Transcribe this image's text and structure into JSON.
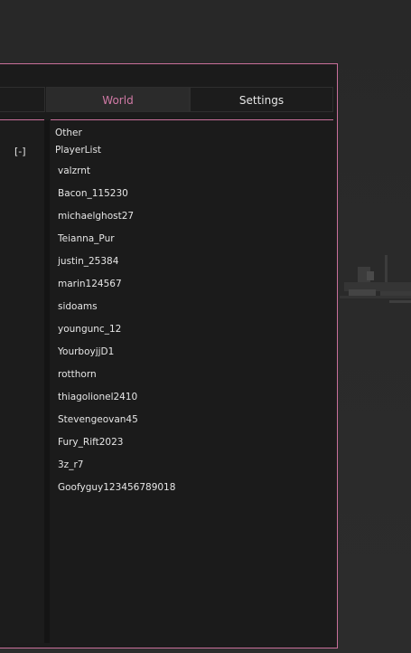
{
  "tabs": {
    "world_label": "World",
    "settings_label": "Settings",
    "active": "World"
  },
  "left_column": {
    "collapse_label": "[-]"
  },
  "content": {
    "section_other": "Other",
    "section_playerlist": "PlayerList",
    "players": [
      "valzrnt",
      "Bacon_115230",
      "michaelghost27",
      "Teianna_Pur",
      "justin_25384",
      "marin124567",
      "sidoams",
      "youngunc_12",
      "YourboyjjD1",
      "rotthorn",
      "thiagolionel2410",
      "Stevengeovan45",
      "Fury_Rift2023",
      "3z_r7",
      "Goofyguy123456789018"
    ]
  },
  "colors": {
    "accent": "#c9709b",
    "active_tab_text": "#d17aa6",
    "panel_bg": "#1b1b1b",
    "text": "#e6e6e6"
  }
}
